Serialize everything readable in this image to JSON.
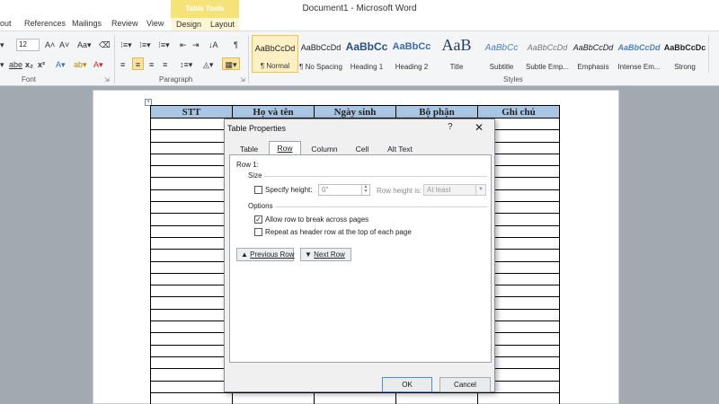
{
  "app": {
    "window_title": "Document1 - Microsoft Word",
    "context_tab_group": "Table Tools"
  },
  "ribbon_tabs": [
    "out",
    "References",
    "Mailings",
    "Review",
    "View",
    "Design",
    "Layout"
  ],
  "ribbon": {
    "font_size": "12",
    "groups": {
      "font": "Font",
      "paragraph": "Paragraph",
      "styles": "Styles"
    },
    "styles": [
      {
        "sample": "AaBbCcDd",
        "name": "¶ Normal"
      },
      {
        "sample": "AaBbCcDd",
        "name": "¶ No Spacing"
      },
      {
        "sample": "AaBbCc",
        "name": "Heading 1"
      },
      {
        "sample": "AaBbCc",
        "name": "Heading 2"
      },
      {
        "sample": "AaB",
        "name": "Title"
      },
      {
        "sample": "AaBbCc",
        "name": "Subtitle"
      },
      {
        "sample": "AaBbCcDd",
        "name": "Subtle Emp..."
      },
      {
        "sample": "AaBbCcDd",
        "name": "Emphasis"
      },
      {
        "sample": "AaBbCcDd",
        "name": "Intense Em..."
      },
      {
        "sample": "AaBbCcDc",
        "name": "Strong"
      }
    ]
  },
  "table": {
    "headers": [
      "STT",
      "Họ và tên",
      "Ngày sinh",
      "Bộ phận",
      "Ghi chú"
    ],
    "header_color": "#a9c7e5"
  },
  "dialog": {
    "title": "Table Properties",
    "help": "?",
    "close": "✕",
    "tabs": [
      "Table",
      "Row",
      "Column",
      "Cell",
      "Alt Text"
    ],
    "active_tab": "Row",
    "row_label": "Row 1:",
    "size_heading": "Size",
    "specify_height_label": "Specify height:",
    "specify_height_checked": false,
    "height_value": "0\"",
    "row_height_is_label": "Row height is:",
    "row_height_is_value": "At least",
    "options_heading": "Options",
    "allow_break_label": "Allow row to break across pages",
    "allow_break_checked": true,
    "repeat_header_label": "Repeat as header row at the top of each page",
    "repeat_header_checked": false,
    "prev_row": "Previous Row",
    "next_row": "Next Row",
    "ok": "OK",
    "cancel": "Cancel"
  }
}
